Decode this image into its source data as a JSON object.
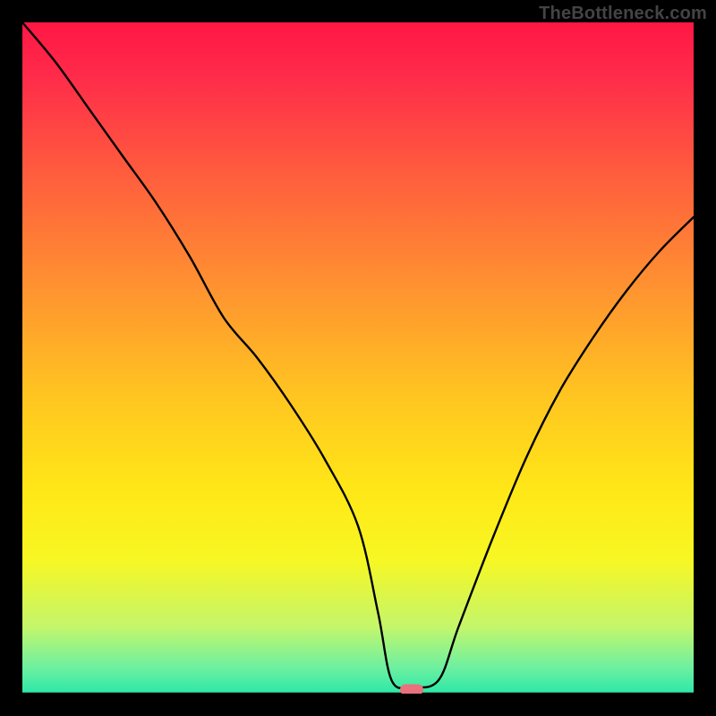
{
  "watermark": "TheBottleneck.com",
  "chart_data": {
    "type": "line",
    "title": "",
    "xlabel": "",
    "ylabel": "",
    "xlim": [
      0,
      100
    ],
    "ylim": [
      0,
      100
    ],
    "grid": false,
    "legend": false,
    "curve": {
      "name": "bottleneck-percentage",
      "x": [
        0,
        5,
        10,
        15,
        20,
        25,
        30,
        35,
        40,
        45,
        50,
        53,
        55,
        58,
        62,
        65,
        70,
        75,
        80,
        85,
        90,
        95,
        100
      ],
      "y": [
        100,
        94,
        87,
        80,
        73,
        65,
        56,
        50,
        43,
        35,
        25,
        12,
        2,
        1,
        2,
        10,
        23,
        35,
        45,
        53,
        60,
        66,
        71
      ]
    },
    "baseline": {
      "name": "zero-line",
      "x": [
        0,
        100
      ],
      "y": [
        0,
        0
      ]
    },
    "marker": {
      "name": "current-config",
      "x": 58,
      "y": 0.6,
      "color": "#e9717e"
    },
    "background_gradient": {
      "stops": [
        {
          "offset": 0.0,
          "color": "#ff1744"
        },
        {
          "offset": 0.08,
          "color": "#ff2b4a"
        },
        {
          "offset": 0.22,
          "color": "#ff5b3e"
        },
        {
          "offset": 0.4,
          "color": "#ff9430"
        },
        {
          "offset": 0.55,
          "color": "#ffc321"
        },
        {
          "offset": 0.7,
          "color": "#ffe817"
        },
        {
          "offset": 0.8,
          "color": "#f7f723"
        },
        {
          "offset": 0.9,
          "color": "#c4f66a"
        },
        {
          "offset": 0.96,
          "color": "#6ff0a0"
        },
        {
          "offset": 1.0,
          "color": "#2be8a8"
        }
      ]
    }
  }
}
